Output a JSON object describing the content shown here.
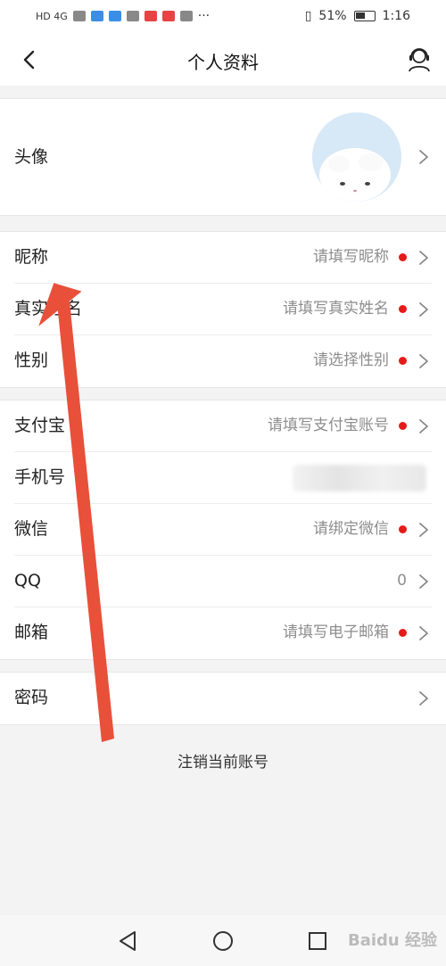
{
  "status_bar": {
    "network": "HD 4G",
    "battery": "51%",
    "time": "1:16",
    "more": "···"
  },
  "header": {
    "title": "个人资料",
    "back_icon": "chevron-left-icon",
    "service_icon": "customer-service-icon"
  },
  "avatar_section": {
    "label": "头像"
  },
  "basic_section": {
    "items": [
      {
        "label": "昵称",
        "value": "请填写昵称",
        "dot": true
      },
      {
        "label": "真实姓名",
        "value": "请填写真实姓名",
        "dot": true
      },
      {
        "label": "性别",
        "value": "请选择性别",
        "dot": true
      }
    ]
  },
  "account_section": {
    "items": [
      {
        "label": "支付宝",
        "value": "请填写支付宝账号",
        "dot": true
      },
      {
        "label": "手机号",
        "value": "",
        "dot": false
      },
      {
        "label": "微信",
        "value": "请绑定微信",
        "dot": true
      },
      {
        "label": "QQ",
        "value": "0",
        "dot": false
      },
      {
        "label": "邮箱",
        "value": "请填写电子邮箱",
        "dot": true
      }
    ]
  },
  "security_section": {
    "items": [
      {
        "label": "密码"
      }
    ]
  },
  "logout_label": "注销当前账号",
  "watermark": "Baidu 经验",
  "colors": {
    "dot": "#e61a1a",
    "annotation_arrow": "#e8503a"
  }
}
